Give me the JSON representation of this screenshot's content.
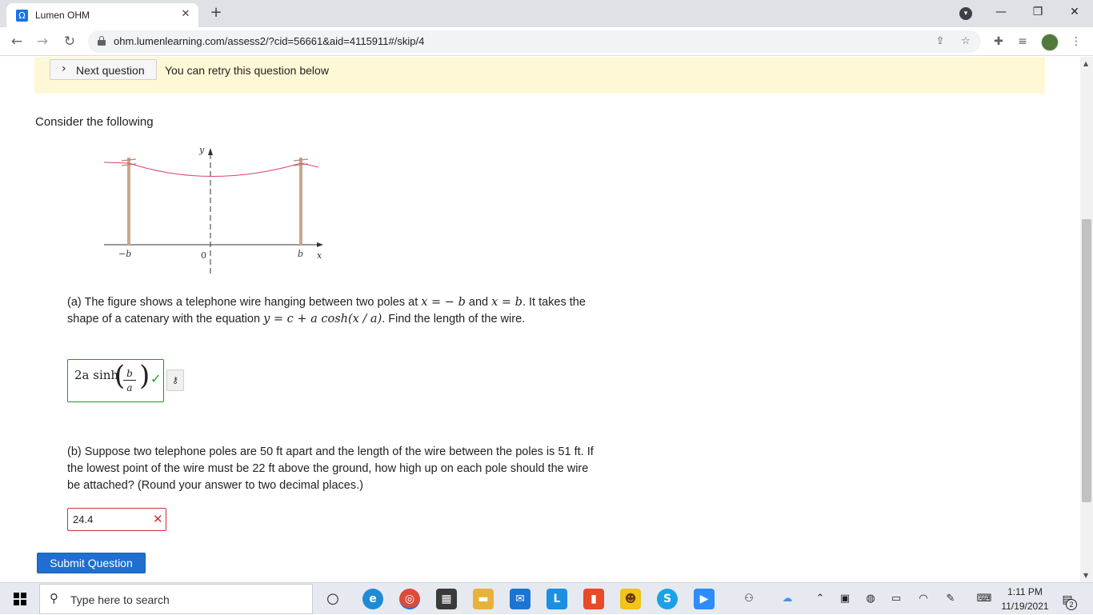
{
  "browser": {
    "tab_title": "Lumen OHM",
    "tab_favicon": "Ω",
    "url": "ohm.lumenlearning.com/assess2/?cid=56661&aid=4115911#/skip/4",
    "accent_color": "#1a73e8"
  },
  "notice": {
    "next_label": "Next question",
    "message": "You can retry this question below"
  },
  "question": {
    "intro": "Consider the following",
    "figure": {
      "y_label": "y",
      "x_label": "x",
      "neg_b_label": "−b",
      "zero_label": "0",
      "b_label": "b",
      "wire_color": "#e0407a",
      "pole_color": "#c9a88c"
    },
    "part_a": {
      "text_1": "(a) The figure shows a telephone wire hanging between two poles at ",
      "eq_1": "x = − b",
      "text_2": " and ",
      "eq_2": "x = b",
      "text_3": ". It takes the shape of a catenary with the equation ",
      "eq_3": "y = c + a cosh(x / a)",
      "text_4": ". Find the length of the wire.",
      "answer_prefix": "2a sinh",
      "answer_num": "b",
      "answer_den": "a",
      "status": "correct",
      "status_color": "#15a015"
    },
    "part_b": {
      "text": "(b) Suppose two telephone poles are 50 ft apart and the length of the wire between the poles is 51 ft. If the lowest point of the wire must be 22 ft above the ground, how high up on each pole should the wire be attached? (Round your answer to two decimal places.)",
      "answer": "24.4",
      "status": "incorrect",
      "status_color": "#d32f2f"
    },
    "submit_label": "Submit Question"
  },
  "taskbar": {
    "search_placeholder": "Type here to search",
    "time": "1:11 PM",
    "date": "11/19/2021",
    "notification_count": "2"
  }
}
